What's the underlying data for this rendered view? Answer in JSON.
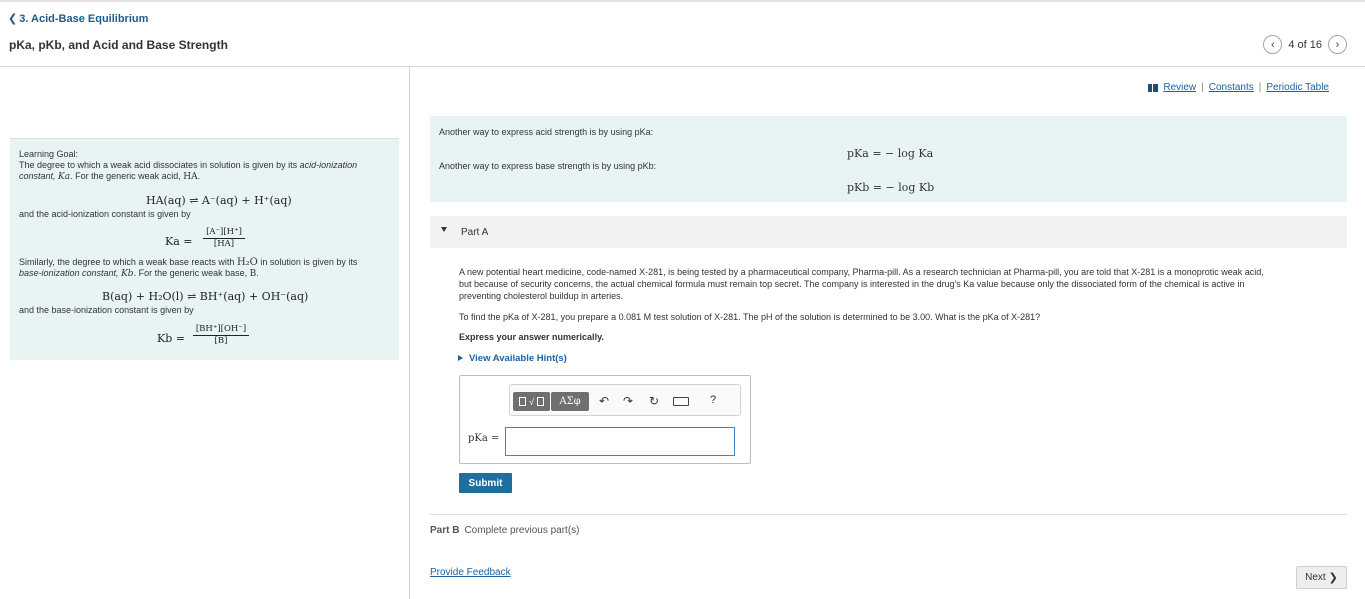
{
  "header": {
    "breadcrumb": "3. Acid-Base Equilibrium",
    "title": "pKa, pKb, and Acid and Base Strength",
    "pager": "4 of 16"
  },
  "links": {
    "review": "Review",
    "constants": "Constants",
    "periodic_table": "Periodic Table",
    "sep": "|"
  },
  "learning_goal": {
    "heading": "Learning Goal:",
    "p1a": "The degree to which a weak acid dissociates in solution is given by its ",
    "p1b": "acid-ionization",
    "p1c": "constant,",
    "p1d": ". For the generic weak acid,",
    "eq_acid": "HA(aq) ⇌ A⁻(aq) + H⁺(aq)",
    "p2": "and the acid-ionization constant is given by",
    "ka_lhs": "Ka =",
    "ka_num": "[A⁻][H⁺]",
    "ka_den": "[HA]",
    "p3a": "Similarly, the degree to which a weak base reacts with ",
    "p3b": " in solution is given by its",
    "p3c": "base-ionization constant,",
    "p3d": ". For the generic weak base,",
    "eq_base": "B(aq) + H₂O(l) ⇌ BH⁺(aq) + OH⁻(aq)",
    "p4": "and the base-ionization constant is given by",
    "kb_lhs": "Kb =",
    "kb_num": "[BH⁺][OH⁻]",
    "kb_den": "[B]",
    "ka_sym": "Ka",
    "kb_sym": "Kb",
    "ha_sym": "HA",
    "b_sym": "B",
    "h2o_sym": "H₂O"
  },
  "intro": {
    "line1": "Another way to express acid strength is by using pKa:",
    "eq1": "pKa = − log Ka",
    "line2": "Another way to express base strength is by using pKb:",
    "eq2": "pKb = − log Kb"
  },
  "partA": {
    "label": "Part A",
    "problem_l1": "A new potential heart medicine, code-named X-281, is being tested by a pharmaceutical company, Pharma-pill. As a research technician at Pharma-pill, you are told that X-281 is a monoprotic weak acid,",
    "problem_l2": "but because of security concerns, the actual chemical formula must remain top secret. The company is interested in the drug's Ka value because only the dissociated form of the chemical is active in",
    "problem_l3": "preventing cholesterol buildup in arteries.",
    "question": "To find the pKa of X-281, you prepare a 0.081 M test solution of X-281. The pH of the solution is determined to be 3.00. What is the pKa of X-281?",
    "instruction": "Express your answer numerically.",
    "hints": "View Available Hint(s)",
    "answer_label": "pKa =",
    "answer_value": "",
    "toolbar_greek": "ΑΣφ",
    "toolbar_help": "?",
    "submit": "Submit"
  },
  "partB": {
    "label": "Part B",
    "status": "Complete previous part(s)"
  },
  "footer": {
    "feedback": "Provide Feedback",
    "next": "Next"
  }
}
